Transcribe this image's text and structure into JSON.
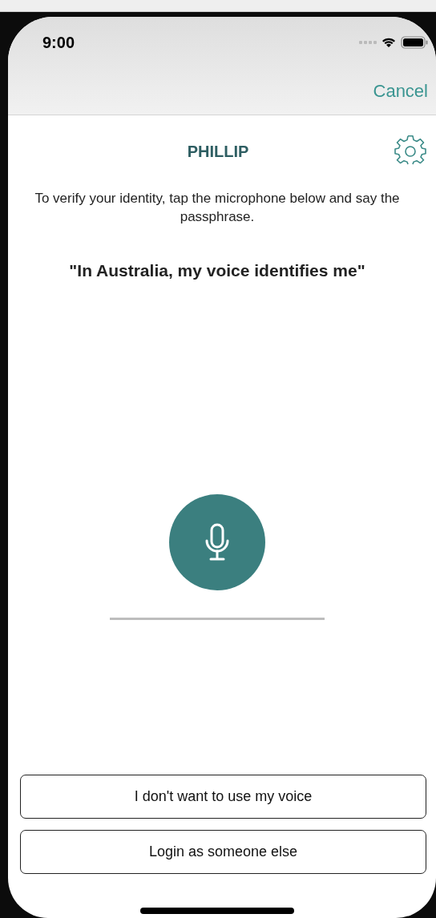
{
  "status_bar": {
    "time": "9:00"
  },
  "nav_bar": {
    "action": "Cancel"
  },
  "header": {
    "title": "PHILLIP"
  },
  "instruction": "To verify your identity, tap the microphone below and say the passphrase.",
  "passphrase": "\"In Australia, my voice identifies me\"",
  "buttons": [
    "I don't want to use my voice",
    "Login as someone else"
  ]
}
